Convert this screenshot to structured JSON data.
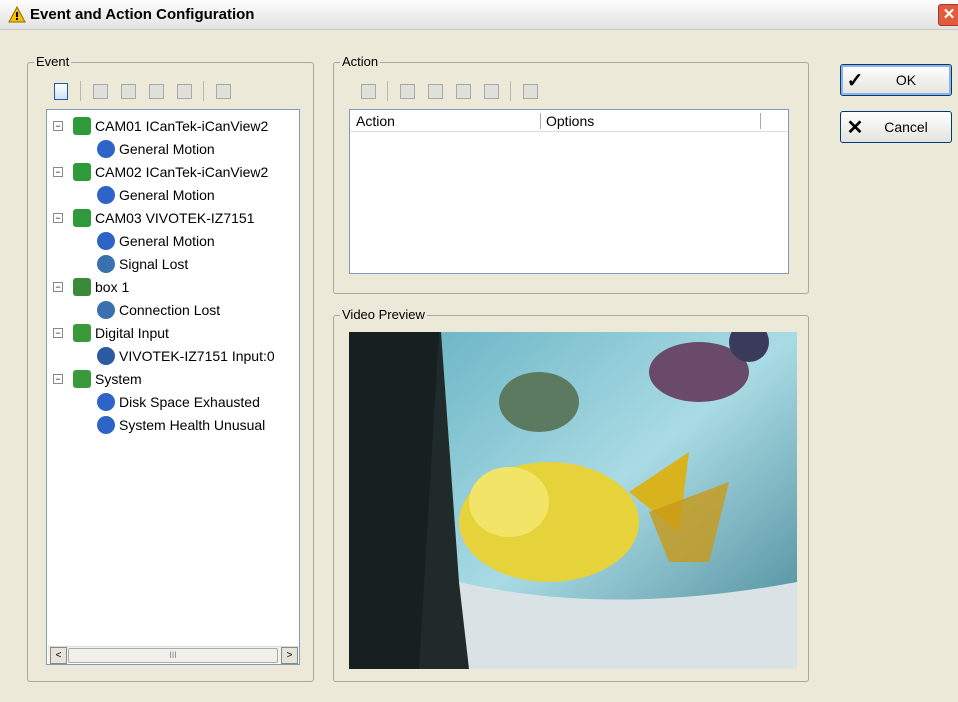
{
  "window": {
    "title": "Event and Action Configuration"
  },
  "event_group": {
    "legend": "Event",
    "toolbar": [
      "new-icon",
      "delete-icon",
      "copy-icon",
      "paste-icon",
      "edit-icon",
      "properties-icon"
    ],
    "tree": [
      {
        "label": "CAM01 ICanTek-iCanView2",
        "icon": "camera-icon",
        "level": 0
      },
      {
        "label": "General Motion",
        "icon": "motion-icon",
        "level": 1
      },
      {
        "label": "CAM02 ICanTek-iCanView2",
        "icon": "camera-icon",
        "level": 0
      },
      {
        "label": "General Motion",
        "icon": "motion-icon",
        "level": 1
      },
      {
        "label": "CAM03 VIVOTEK-IZ7151",
        "icon": "camera-icon",
        "level": 0
      },
      {
        "label": "General Motion",
        "icon": "motion-icon",
        "level": 1
      },
      {
        "label": "Signal Lost",
        "icon": "signal-lost-icon",
        "level": 1
      },
      {
        "label": "box 1",
        "icon": "box-icon",
        "level": 0
      },
      {
        "label": "Connection Lost",
        "icon": "connection-lost-icon",
        "level": 1
      },
      {
        "label": "Digital Input",
        "icon": "digital-input-icon",
        "level": 0
      },
      {
        "label": "VIVOTEK-IZ7151 Input:0",
        "icon": "input-icon",
        "level": 1
      },
      {
        "label": "System",
        "icon": "system-icon",
        "level": 0
      },
      {
        "label": "Disk Space Exhausted",
        "icon": "disk-warning-icon",
        "level": 1
      },
      {
        "label": "System Health Unusual",
        "icon": "health-icon",
        "level": 1
      }
    ],
    "scroll_left": "<",
    "scroll_right": ">",
    "scroll_thumb": "III"
  },
  "action_group": {
    "legend": "Action",
    "toolbar": [
      "new-action-icon",
      "delete-action-icon",
      "copy-action-icon",
      "paste-action-icon",
      "edit-action-icon",
      "test-action-icon"
    ],
    "columns": [
      "Action",
      "Options"
    ]
  },
  "video_group": {
    "legend": "Video Preview"
  },
  "buttons": {
    "ok": "OK",
    "cancel": "Cancel"
  },
  "colors": {
    "tree_border": "#7f9db9",
    "camera_green": "#2e9a3a",
    "motion_blue": "#2e64c8"
  }
}
